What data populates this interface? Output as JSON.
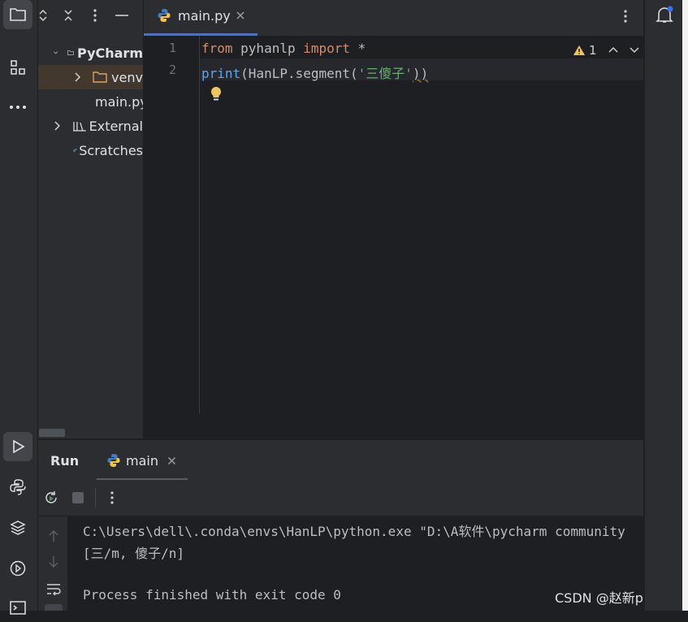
{
  "editor": {
    "tab_label": "main.py",
    "lines": [
      {
        "number": "1",
        "tokens": [
          {
            "text": "from",
            "kind": "kw"
          },
          {
            "text": " pyhanlp ",
            "kind": "txt"
          },
          {
            "text": "import",
            "kind": "kw"
          },
          {
            "text": " *",
            "kind": "txt"
          }
        ]
      },
      {
        "number": "2",
        "tokens": [
          {
            "text": "print",
            "kind": "fn"
          },
          {
            "text": "(HanLP.segment(",
            "kind": "txt"
          },
          {
            "text": "'三傻子'",
            "kind": "str"
          },
          {
            "text": "))",
            "kind": "txt"
          }
        ]
      }
    ],
    "warning_count": "1"
  },
  "project_tree": {
    "items": [
      {
        "label": "PyCharm",
        "kind": "project"
      },
      {
        "label": "venv",
        "kind": "folder"
      },
      {
        "label": "main.py",
        "kind": "file"
      },
      {
        "label": "External",
        "kind": "library"
      },
      {
        "label": "Scratches",
        "kind": "scratch"
      }
    ]
  },
  "run_panel": {
    "title": "Run",
    "config_tab": "main",
    "console_lines": [
      "C:\\Users\\dell\\.conda\\envs\\HanLP\\python.exe \"D:\\A软件\\pycharm community",
      "[三/m, 傻子/n]",
      "",
      "Process finished with exit code 0"
    ]
  },
  "watermark": "CSDN @赵新paipai",
  "colors": {
    "keyword": "#cf8e6d",
    "function": "#56a8f5",
    "string": "#6aab73",
    "text": "#bcbec4",
    "accent": "#3574f0",
    "warning": "#f2c55c"
  }
}
